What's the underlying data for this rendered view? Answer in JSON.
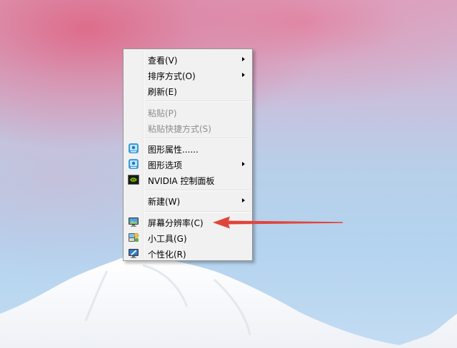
{
  "context_menu": {
    "items": [
      {
        "label": "查看(V)",
        "submenu": true,
        "enabled": true
      },
      {
        "label": "排序方式(O)",
        "submenu": true,
        "enabled": true
      },
      {
        "label": "刷新(E)",
        "submenu": false,
        "enabled": true
      },
      {
        "label": "粘贴(P)",
        "submenu": false,
        "enabled": false
      },
      {
        "label": "粘贴快捷方式(S)",
        "submenu": false,
        "enabled": false
      },
      {
        "label": "图形属性......",
        "submenu": false,
        "enabled": true,
        "icon": "intel-graphics-icon"
      },
      {
        "label": "图形选项",
        "submenu": true,
        "enabled": true,
        "icon": "intel-graphics-icon"
      },
      {
        "label": "NVIDIA 控制面板",
        "submenu": false,
        "enabled": true,
        "icon": "nvidia-icon"
      },
      {
        "label": "新建(W)",
        "submenu": true,
        "enabled": true
      },
      {
        "label": "屏幕分辨率(C)",
        "submenu": false,
        "enabled": true,
        "icon": "monitor-icon"
      },
      {
        "label": "小工具(G)",
        "submenu": false,
        "enabled": true,
        "icon": "gadgets-icon"
      },
      {
        "label": "个性化(R)",
        "submenu": false,
        "enabled": true,
        "icon": "personalize-icon"
      }
    ]
  },
  "annotation": {
    "color": "#e0453a",
    "points_to": "屏幕分辨率(C)"
  },
  "colors": {
    "menu_bg": "#f1f1f1",
    "disabled_text": "#8d8d8d",
    "nvidia_green": "#76b900"
  }
}
